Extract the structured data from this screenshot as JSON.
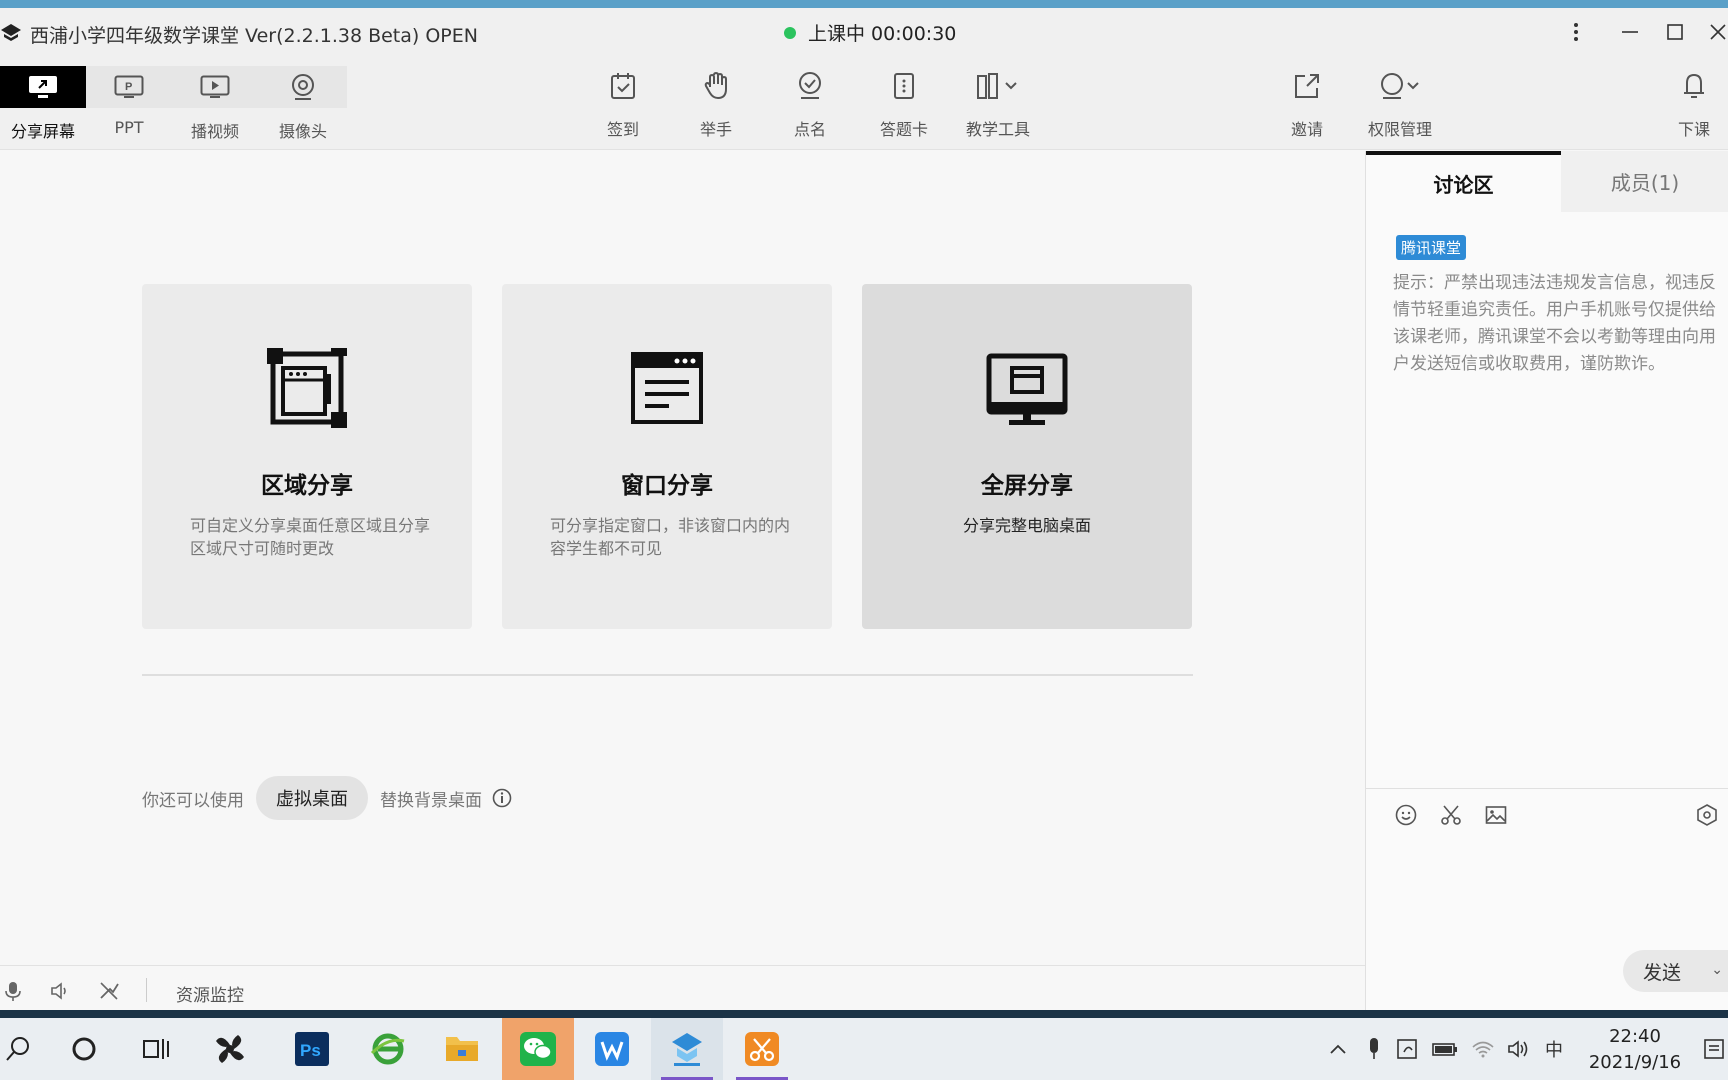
{
  "window": {
    "title": "西浦小学四年级数学课堂 Ver(2.2.1.38 Beta)  OPEN",
    "live_status": "上课中 00:00:30"
  },
  "share_tabs": [
    {
      "label": "分享屏幕",
      "icon": "share-screen-icon",
      "active": true
    },
    {
      "label": "PPT",
      "icon": "ppt-icon",
      "active": false
    },
    {
      "label": "播视频",
      "icon": "play-video-icon",
      "active": false
    },
    {
      "label": "摄像头",
      "icon": "camera-icon",
      "active": false
    }
  ],
  "tools": {
    "checkin": "签到",
    "raise_hand": "举手",
    "roll_call": "点名",
    "answer_card": "答题卡",
    "teaching_tools": "教学工具",
    "invite": "邀请",
    "permissions": "权限管理",
    "end_class": "下课"
  },
  "cards": {
    "region": {
      "title": "区域分享",
      "desc": "可自定义分享桌面任意区域且分享区域尺寸可随时更改"
    },
    "window": {
      "title": "窗口分享",
      "desc": "可分享指定窗口，非该窗口内的内容学生都不可见"
    },
    "fullscreen": {
      "title": "全屏分享",
      "desc": "分享完整电脑桌面"
    }
  },
  "virtual_desktop": {
    "prefix": "你还可以使用",
    "button": "虚拟桌面",
    "suffix": "替换背景桌面"
  },
  "statusbar": {
    "monitor_label": "资源监控"
  },
  "panel": {
    "tab_discussion": "讨论区",
    "tab_members": "成员(1)",
    "badge": "腾讯课堂",
    "notice": "提示：严禁出现违法违规发言信息，视违反情节轻重追究责任。用户手机账号仅提供给该课老师，腾讯课堂不会以考勤等理由向用户发送短信或收取费用，谨防欺诈。",
    "send": "发送"
  },
  "taskbar": {
    "ime": "中",
    "time": "22:40",
    "date": "2021/9/16"
  },
  "colors": {
    "live_dot": "#2bc35e",
    "badge": "#2e8bd6",
    "active_tab": "#000000"
  }
}
